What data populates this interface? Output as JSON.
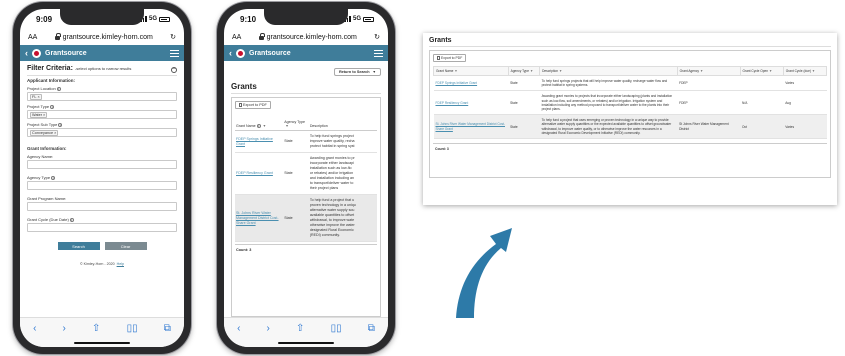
{
  "colors": {
    "brand": "#3f7d9a",
    "arrow": "#2d7aa8",
    "link": "#4a8fb0",
    "logo": "#c8102e"
  },
  "phone1": {
    "time": "9:09",
    "signal": "5G",
    "text_size": "AA",
    "url": "grantsource.kimley-horn.com",
    "app_title": "Grantsource",
    "filter_title": "Filter Criteria:",
    "filter_hint": "-select options to narrow results",
    "applicant_heading": "Applicant Information:",
    "project_location_label": "Project Location",
    "project_location_chip": "FL",
    "project_type_label": "Project Type",
    "project_type_chip": "Water",
    "project_subtype_label": "Project Sub Type",
    "project_subtype_chip": "Conveyance",
    "grant_heading": "Grant Information:",
    "agency_name_label": "Agency Name:",
    "agency_type_label": "Agency Type",
    "grant_program_label": "Grant Program Name:",
    "grant_cycle_label": "Grant Cycle (Due Date)",
    "search_button": "Search",
    "clear_button": "Clear",
    "footer": "© Kimley-Horn - 2020",
    "help": "Help"
  },
  "phone2": {
    "time": "9:10",
    "signal": "5G",
    "text_size": "AA",
    "url": "grantsource.kimley-horn.com",
    "app_title": "Grantsource",
    "return_button": "Return to Search",
    "grants_title": "Grants",
    "export_button": "Export to PDF",
    "columns": [
      "Grant Name",
      "Agency Type",
      "Description"
    ],
    "rows": [
      {
        "name": "FDEP Springs Initiative Grant",
        "type": "State",
        "desc": [
          "To help fund springs project",
          "improve water quality, recha",
          "protect habitat in spring syst"
        ]
      },
      {
        "name": "FDEP Resiliency Grant",
        "type": "State",
        "desc": [
          "Awarding grant monies to pr",
          "incorporate either landscapi",
          "installation such as low-flo",
          "or rebates) and/or irrigation",
          "and installation including an",
          "to transport/deliver water to",
          "their project plans"
        ]
      },
      {
        "name": "St. Johns River Water Management District Cost-Share Grant",
        "type": "State",
        "desc": [
          "To help fund a project that u",
          "proven technology in a uniqu",
          "alternative water supply sou",
          "available quantities to offset",
          "withdrawal, to improve wate",
          "otherwise improve the water",
          "designated Rural Economic",
          "(REDI) community."
        ]
      }
    ],
    "count": "Count: 3",
    "footer": "© Kimley-Horn - 2020",
    "help": "Help"
  },
  "desktop": {
    "title": "Grants",
    "export_button": "Export to PDF",
    "columns": [
      "Grant Name",
      "Agency Type",
      "Description",
      "Grant Agency",
      "Grant Cycle Open",
      "Grant Cycle (due)"
    ],
    "rows": [
      {
        "name": "FDEP Springs Initiative Grant",
        "type": "State",
        "desc": "To help fund springs projects that will help improve water quality, recharge water flow and protect habitat in spring systems.",
        "agency": "FDEP",
        "open": "",
        "due": "Varies"
      },
      {
        "name": "FDEP Resiliency Grant",
        "type": "State",
        "desc": "Awarding grant monies to projects that incorporate either landscaping (plants and installation such as low-flow, soil amendments, or rebates) and/or irrigation. Irrigation system and installation including any method proposed to transport/deliver water to the plants into their project plans.",
        "agency": "FDEP",
        "open": "N/A",
        "due": "Aug"
      },
      {
        "name": "St. Johns River Water Management District Cost-Share Grant",
        "type": "State",
        "desc": "To help fund a project that uses emerging or proven technology in a unique way to provide alternative water supply quantities or the expected available quantities to offset groundwater withdrawal, to improve water quality, or to otherwise improve the water resources in a designated Rural Economic Development Initiative (REDI) community.",
        "agency": "St Johns River Water Management District",
        "open": "Oct",
        "due": "Varies"
      }
    ],
    "count": "Count: 3"
  }
}
